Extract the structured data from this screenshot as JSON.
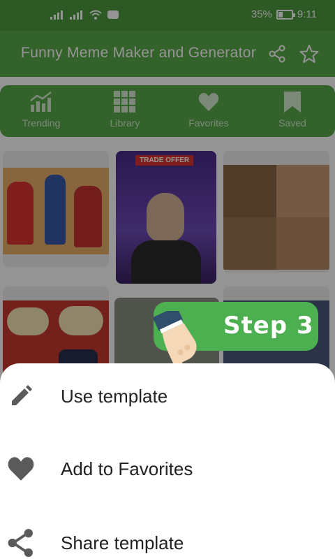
{
  "status_bar": {
    "battery": "35%",
    "time": "9:11",
    "battery_level": 0.35
  },
  "app_bar": {
    "title": "Funny Meme Maker and Generator",
    "share_icon": "share-icon",
    "star_icon": "star-outline-icon"
  },
  "categories": [
    {
      "label": "Trending",
      "icon": "trending-chart-icon"
    },
    {
      "label": "Library",
      "icon": "grid-icon"
    },
    {
      "label": "Favorites",
      "icon": "heart-icon"
    },
    {
      "label": "Saved",
      "icon": "bookmark-icon"
    }
  ],
  "grid": {
    "trade_offer_label": "TRADE OFFER"
  },
  "sheet": {
    "items": [
      {
        "label": "Use template",
        "icon": "pencil-icon"
      },
      {
        "label": "Add to Favorites",
        "icon": "heart-icon"
      },
      {
        "label": "Share template",
        "icon": "share-icon"
      }
    ]
  },
  "step_badge": {
    "label": "Step 3"
  },
  "colors": {
    "primary": "#5aa94b",
    "step_green": "#4caf50",
    "text_dark": "#222222"
  }
}
